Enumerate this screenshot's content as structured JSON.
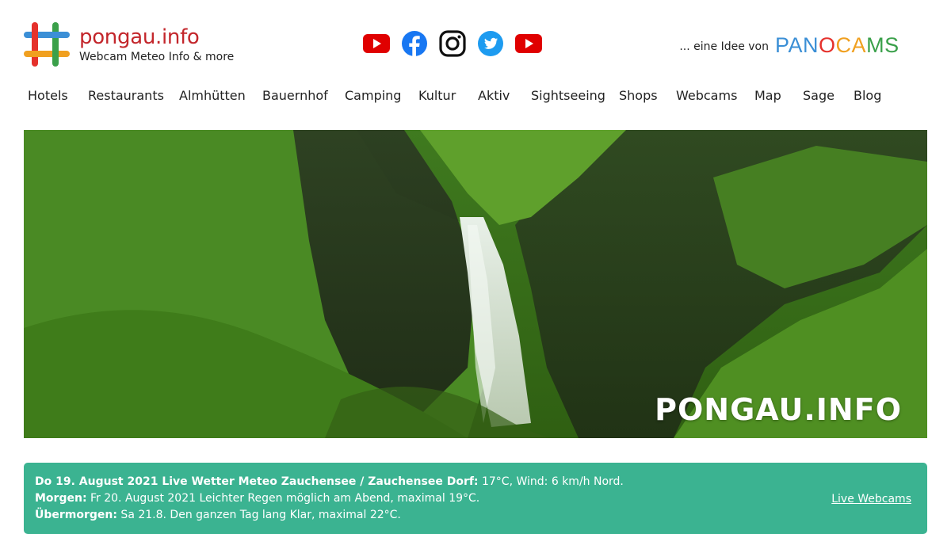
{
  "brand": {
    "name": "pongau.info",
    "tagline": "Webcam Meteo Info & more"
  },
  "social": [
    {
      "icon": "youtube-icon",
      "color": "#e00000"
    },
    {
      "icon": "facebook-icon",
      "color": "#1877f2"
    },
    {
      "icon": "instagram-icon",
      "color": "#111111"
    },
    {
      "icon": "twitter-icon",
      "color": "#1d9bf0"
    },
    {
      "icon": "youtube-icon",
      "color": "#e00000"
    }
  ],
  "idea": {
    "text": "... eine Idee von",
    "brand_letters": [
      {
        "ch": "P",
        "color": "#3b8fd6"
      },
      {
        "ch": "A",
        "color": "#3b8fd6"
      },
      {
        "ch": "N",
        "color": "#3b8fd6"
      },
      {
        "ch": "O",
        "color": "#e5312c"
      },
      {
        "ch": "C",
        "color": "#f0a020"
      },
      {
        "ch": "A",
        "color": "#f0a020"
      },
      {
        "ch": "M",
        "color": "#3aa04a"
      },
      {
        "ch": "S",
        "color": "#3aa04a"
      }
    ]
  },
  "nav": [
    "Hotels",
    "Restaurants",
    "Almhütten",
    "Bauernhof",
    "Camping",
    "Kultur",
    "Aktiv",
    "Sightseeing",
    "Shops",
    "Webcams",
    "Map",
    "Sage",
    "Blog"
  ],
  "hero": {
    "title": "PONGAU.INFO"
  },
  "weather": {
    "today_label": "Do 19. August 2021 Live Wetter Meteo Zauchensee / Zauchensee Dorf:",
    "today_value": " 17°C, Wind: 6 km/h Nord.",
    "tomorrow_label": "Morgen:",
    "tomorrow_value": " Fr 20. August 2021 Leichter Regen möglich am Abend, maximal 19°C.",
    "dayafter_label": "Übermorgen:",
    "dayafter_value": " Sa 21.8. Den ganzen Tag lang Klar, maximal 22°C.",
    "link": "Live Webcams",
    "background": "#3bb391"
  }
}
